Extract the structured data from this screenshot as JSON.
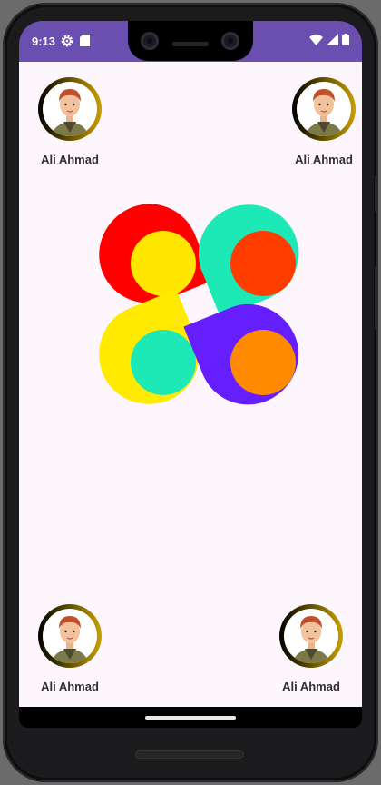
{
  "status_bar": {
    "time": "9:13",
    "left_icons": [
      "settings-gear-icon",
      "sd-card-icon"
    ],
    "right_icons": [
      "wifi-icon",
      "cell-signal-icon",
      "battery-icon"
    ],
    "color": "#6a4fb0"
  },
  "profiles": [
    {
      "name": "Ali Ahmad",
      "position": "top-left"
    },
    {
      "name": "Ali Ahmad",
      "position": "top-right"
    },
    {
      "name": "Ali Ahmad",
      "position": "bottom-left"
    },
    {
      "name": "Ali Ahmad",
      "position": "bottom-right"
    }
  ],
  "petals": [
    {
      "position": "top-left",
      "outer_color": "#ff0000",
      "inner_color": "#ffe600"
    },
    {
      "position": "top-right",
      "outer_color": "#1de9b6",
      "inner_color": "#ff3d00"
    },
    {
      "position": "bottom-left",
      "outer_color": "#ffea00",
      "inner_color": "#1de9b6"
    },
    {
      "position": "bottom-right",
      "outer_color": "#651fff",
      "inner_color": "#ff8a00"
    }
  ],
  "colors": {
    "background": "#fdf6fd",
    "name_text": "#303030",
    "avatar_ring_start": "#000000",
    "avatar_ring_end": "#c9a000"
  }
}
